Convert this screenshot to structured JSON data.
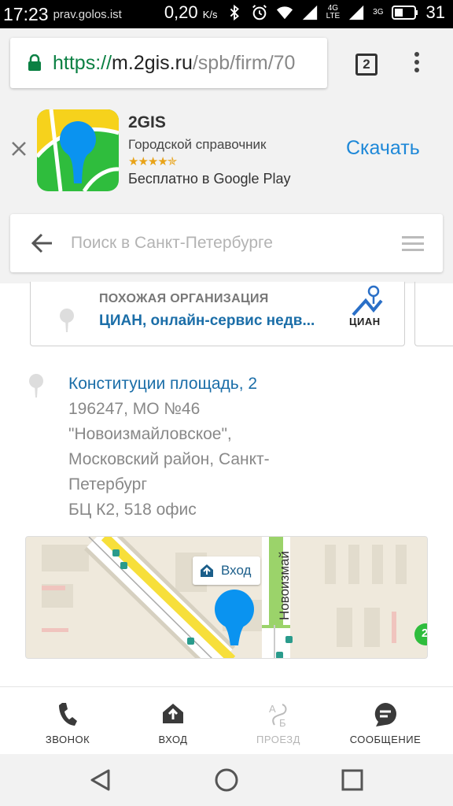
{
  "status_bar": {
    "time": "17:23",
    "watermark": "prav.golos.ist",
    "speed": "0,20",
    "speed_unit": "K/s",
    "net_top": "4G",
    "net_bottom": "LTE",
    "net2": "3G",
    "battery": "31"
  },
  "browser": {
    "url_scheme": "https://",
    "url_host": "m.2gis.ru",
    "url_path": "/spb/firm/70",
    "tab_count": "2"
  },
  "app_banner": {
    "name": "2GIS",
    "subtitle": "Городской справочник",
    "stars": "★★★★✯",
    "store_text": "Бесплатно в Google Play",
    "download_label": "Скачать"
  },
  "search": {
    "placeholder": "Поиск в Санкт-Петербурге"
  },
  "similar_org": {
    "label": "ПОХОЖАЯ ОРГАНИЗАЦИЯ",
    "title": "ЦИАН, онлайн-сервис недв...",
    "logo_text": "ЦИАН"
  },
  "address": {
    "street": "Конституции площадь, 2",
    "lines": [
      "196247, МО №46",
      "\"Новоизмайловское\",",
      "Московский район, Санкт-",
      "Петербург",
      "БЦ К2, 518 офис"
    ]
  },
  "map": {
    "street_label": "Новоизмай",
    "entrance_label": "Вход",
    "badge": "2"
  },
  "actions": [
    {
      "label": "ЗВОНОК",
      "icon": "phone-icon",
      "enabled": true
    },
    {
      "label": "ВХОД",
      "icon": "entrance-icon",
      "enabled": true
    },
    {
      "label": "ПРОЕЗД",
      "icon": "route-icon",
      "enabled": false
    },
    {
      "label": "СООБЩЕНИЕ",
      "icon": "message-icon",
      "enabled": true
    }
  ],
  "colors": {
    "link_blue": "#1b6ea8",
    "download_blue": "#1e88d8",
    "pin_blue": "#0a93f0",
    "star_orange": "#e8a318",
    "url_green": "#0b8043"
  }
}
